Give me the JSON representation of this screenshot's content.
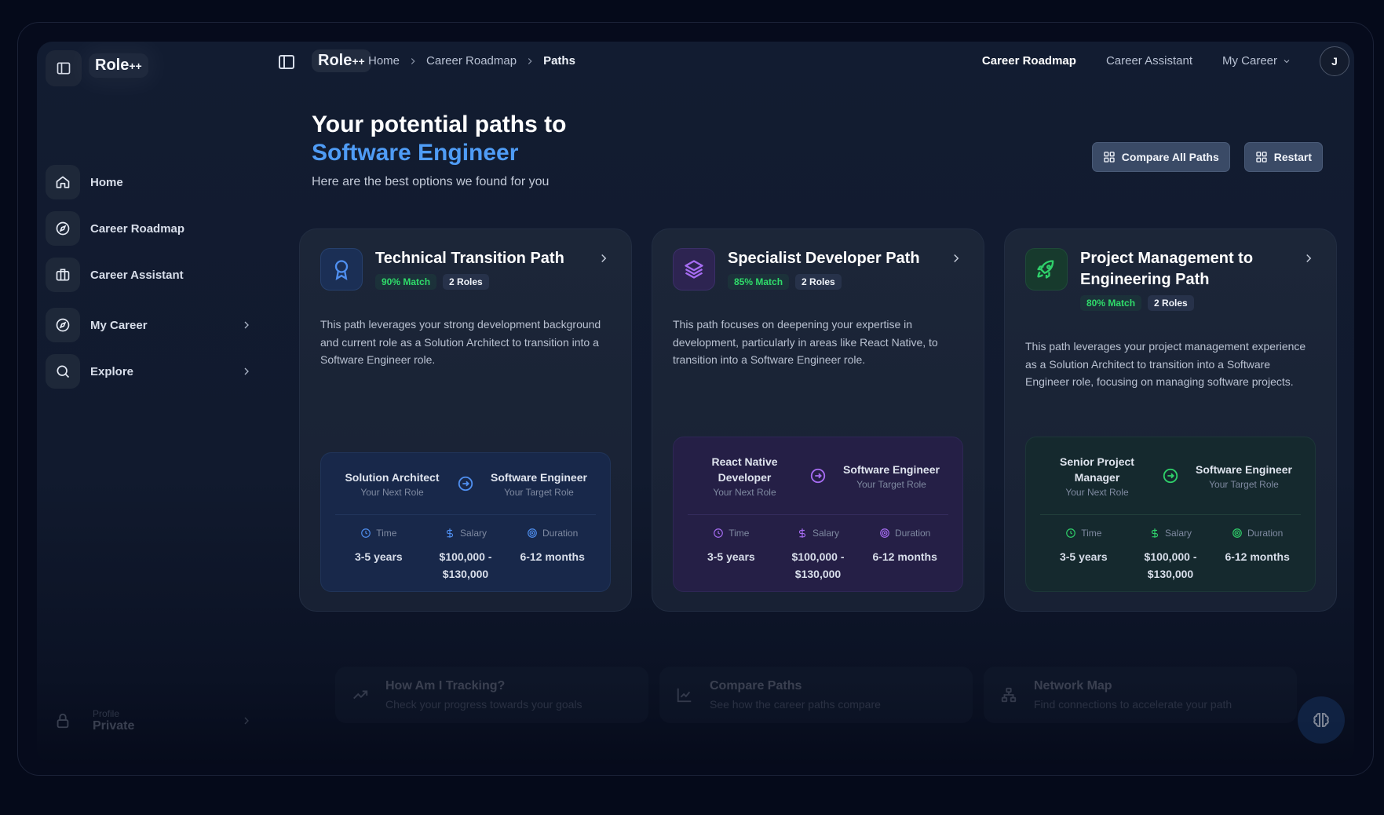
{
  "sidebar": {
    "logo_main": "Role",
    "logo_suffix": "++",
    "items": [
      {
        "label": "Home",
        "icon": "home-icon"
      },
      {
        "label": "Career Roadmap",
        "icon": "compass-icon"
      },
      {
        "label": "Career Assistant",
        "icon": "briefcase-icon"
      },
      {
        "label": "My Career",
        "icon": "compass-icon"
      },
      {
        "label": "Explore",
        "icon": "search-icon"
      }
    ],
    "profile": {
      "small": "Profile",
      "value": "Private"
    }
  },
  "topbar": {
    "logo_main": "Role",
    "logo_suffix": "++",
    "breadcrumbs": [
      "Home",
      "Career Roadmap",
      "Paths"
    ],
    "nav": [
      "Career Roadmap",
      "Career Assistant",
      "My Career"
    ],
    "avatar_initial": "J"
  },
  "hero": {
    "title_line1": "Your potential paths to",
    "title_line2": "Software Engineer",
    "subtitle": "Here are the best options we found for you"
  },
  "actions": {
    "compare": "Compare All Paths",
    "restart": "Restart"
  },
  "cards": [
    {
      "title": "Technical Transition Path",
      "match": "90% Match",
      "roles": "2 Roles",
      "description": "This path leverages your strong development background and current role as a Solution Architect to transition into a Software Engineer role.",
      "from_role": "Solution Architect",
      "from_sub": "Your Next Role",
      "to_role": "Software Engineer",
      "to_sub": "Your Target Role",
      "time_label": "Time",
      "time_value": "3-5 years",
      "salary_label": "Salary",
      "salary_value": "$100,000 - $130,000",
      "duration_label": "Duration",
      "duration_value": "6-12 months",
      "accent": "#4f8ff0"
    },
    {
      "title": "Specialist Developer Path",
      "match": "85% Match",
      "roles": "2 Roles",
      "description": "This path focuses on deepening your expertise in development, particularly in areas like React Native, to transition into a Software Engineer role.",
      "from_role": "React Native Developer",
      "from_sub": "Your Next Role",
      "to_role": "Software Engineer",
      "to_sub": "Your Target Role",
      "time_label": "Time",
      "time_value": "3-5 years",
      "salary_label": "Salary",
      "salary_value": "$100,000 - $130,000",
      "duration_label": "Duration",
      "duration_value": "6-12 months",
      "accent": "#a66cf2"
    },
    {
      "title": "Project Management to Engineering Path",
      "match": "80% Match",
      "roles": "2 Roles",
      "description": "This path leverages your project management experience as a Solution Architect to transition into a Software Engineer role, focusing on managing software projects.",
      "from_role": "Senior Project Manager",
      "from_sub": "Your Next Role",
      "to_role": "Software Engineer",
      "to_sub": "Your Target Role",
      "time_label": "Time",
      "time_value": "3-5 years",
      "salary_label": "Salary",
      "salary_value": "$100,000 - $130,000",
      "duration_label": "Duration",
      "duration_value": "6-12 months",
      "accent": "#2fd06a"
    }
  ],
  "bottom": [
    {
      "title": "How Am I Tracking?",
      "subtitle": "Check your progress towards your goals",
      "icon": "trending-up-icon"
    },
    {
      "title": "Compare Paths",
      "subtitle": "See how the career paths compare",
      "icon": "chart-icon"
    },
    {
      "title": "Network Map",
      "subtitle": "Find connections to accelerate your path",
      "icon": "network-icon"
    }
  ]
}
